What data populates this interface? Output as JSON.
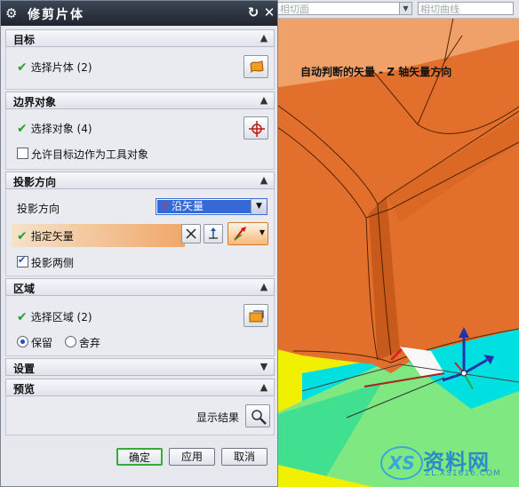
{
  "dialog": {
    "title": "修剪片体",
    "sections": {
      "target": {
        "header": "目标",
        "select_label": "选择片体 (2)"
      },
      "boundary": {
        "header": "边界对象",
        "select_label": "选择对象 (4)",
        "allow_label": "允许目标边作为工具对象",
        "allow_checked": false
      },
      "projection": {
        "header": "投影方向",
        "dir_label": "投影方向",
        "dir_value": "沿矢量",
        "vector_label": "指定矢量",
        "both_sides_label": "投影两侧",
        "both_sides_checked": true
      },
      "region": {
        "header": "区域",
        "select_label": "选择区域 (2)",
        "keep_label": "保留",
        "discard_label": "舍弃",
        "keep_selected": true
      },
      "settings": {
        "header": "设置"
      },
      "preview": {
        "header": "预览",
        "show_result_label": "显示结果"
      }
    },
    "buttons": {
      "ok": "确定",
      "apply": "应用",
      "cancel": "取消"
    }
  },
  "viewport": {
    "combo1": "相切面",
    "combo2": "相切曲线",
    "hint": "自动判断的矢量 - Z 轴矢量方向"
  },
  "watermark": {
    "logo": "XS",
    "brand": "资料网",
    "url": "ZL.XS1616.COM"
  },
  "icons": {
    "target_select": "sheet-body-icon",
    "boundary_select": "crosshair-icon",
    "vector_tools": [
      "vector-dialog-icon",
      "vector-reverse-icon",
      "inferred-vector-icon"
    ],
    "region_select": "region-icon",
    "preview": "magnifier-icon"
  },
  "colors": {
    "title_bar": "#2b323e",
    "check": "#27a035",
    "highlight": "#f0a76a",
    "surface": "#e06a28",
    "ok_border": "#39a83a"
  }
}
